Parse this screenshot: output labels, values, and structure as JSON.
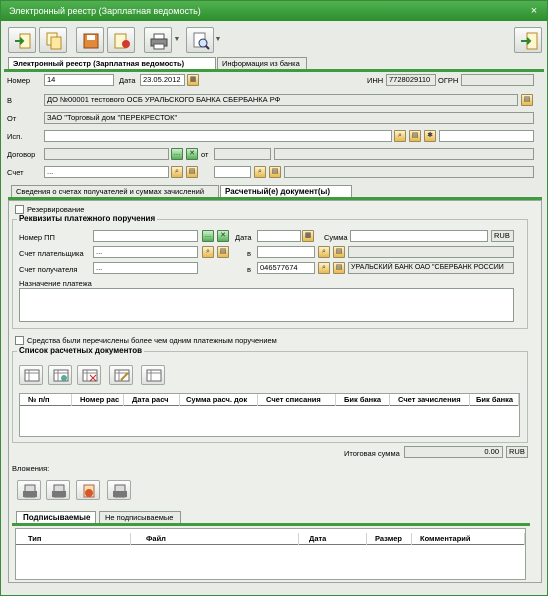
{
  "window": {
    "title": "Электронный реестр (Зарплатная ведомость)",
    "close": "×"
  },
  "toolbar": {
    "arrow": "▼"
  },
  "tabs_main": [
    "Электронный реестр (Зарплатная ведомость)",
    "Информация из банка"
  ],
  "header": {
    "nomer_label": "Номер",
    "nomer_value": "14",
    "data_label": "Дата",
    "data_value": "23.05.2012",
    "inn_label": "ИНН",
    "inn_value": "7728029110",
    "ogrn_label": "ОГРН",
    "v_label": "В",
    "v_value": "ДО №00001 тестового ОСБ УРАЛЬСКОГО БАНКА СБЕРБАНКА РФ",
    "ot_label": "От",
    "ot_value": "ЗАО \"Торговый дом \"ПЕРЕКРЕСТОК\"",
    "isp_label": "Исп.",
    "dogovor_label": "Договор",
    "dogovor_ot": "от",
    "schet_label": "Счет",
    "schet_placeholder": "..."
  },
  "tabs_sub": [
    "Сведения о счетах получателей и суммах зачислений",
    "Расчетный(е) документ(ы)"
  ],
  "payment": {
    "reserve_label": "Резервирование",
    "title": "Реквизиты платежного поручения",
    "nomer_pp": "Номер ПП",
    "data": "Дата",
    "summa": "Сумма",
    "currency": "RUB",
    "schet_plat": "Счет плательщика",
    "v1": "в",
    "schet_pol": "Счет получателя",
    "v2": "в",
    "bik_value": "046577674",
    "bank_name": "УРАЛЬСКИЙ БАНК ОАО \"СБЕРБАНК РОССИИ",
    "naznach": "Назначение платежа",
    "placeholder": "..."
  },
  "multi_label": "Средства были перечислены более чем одним платежным поручением",
  "docs": {
    "title": "Список расчетных документов",
    "columns": [
      "№ п/п",
      "Номер рас",
      "Дата расч",
      "Сумма расч. док",
      "Счет списания",
      "Бик банка",
      "Счет зачисления",
      "Бик банка"
    ]
  },
  "total": {
    "label": "Итоговая сумма",
    "value": "0.00",
    "currency": "RUB"
  },
  "attach": {
    "label": "Вложения:"
  },
  "tabs_sign": [
    "Подписываемые",
    "Не подписываемые"
  ],
  "files": {
    "columns": [
      "Тип",
      "Файл",
      "Дата",
      "Размер",
      "Комментарий"
    ]
  }
}
